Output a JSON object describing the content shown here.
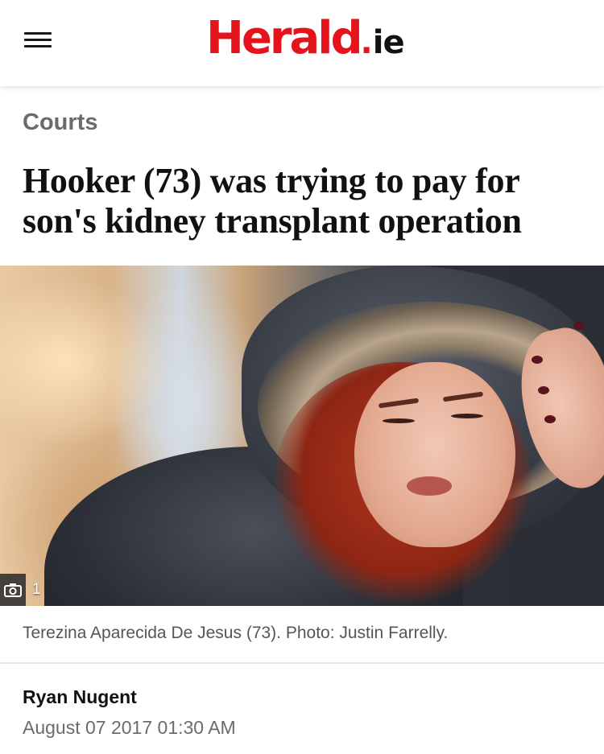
{
  "header": {
    "menu_icon": "hamburger-menu-icon",
    "logo": {
      "main": "Herald",
      "dot": ".",
      "tld": "ie"
    }
  },
  "article": {
    "section": "Courts",
    "headline": "Hooker (73) was trying to pay for son's kidney transplant operation",
    "photo": {
      "count_icon": "camera-icon",
      "count": "1",
      "caption": "Terezina Aparecida De Jesus (73). Photo: Justin Farrelly."
    },
    "author": "Ryan Nugent",
    "date": "August 07 2017 01:30 AM"
  },
  "colors": {
    "brand_red": "#e3141b",
    "text_dark": "#111111",
    "text_muted": "#6b6b6b"
  }
}
